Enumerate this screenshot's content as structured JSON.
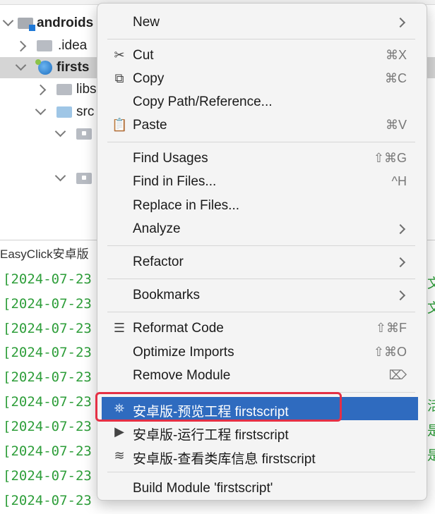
{
  "tree": {
    "items": [
      {
        "label": "androids",
        "bold": true
      },
      {
        "label": ".idea"
      },
      {
        "label": "firsts",
        "bold": true
      },
      {
        "label": "libs"
      },
      {
        "label": "src"
      }
    ]
  },
  "console": {
    "tab_label": "EasyClick安卓版",
    "log_lines": [
      "[2024-07-23",
      "[2024-07-23",
      "[2024-07-23",
      "[2024-07-23",
      "[2024-07-23",
      "[2024-07-23",
      "[2024-07-23",
      "[2024-07-23",
      "[2024-07-23",
      "[2024-07-23"
    ],
    "right_fragments": [
      "板文",
      "板文",
      "激活",
      "码是",
      "口是"
    ]
  },
  "menu": {
    "new": {
      "label": "New"
    },
    "cut": {
      "label": "Cut",
      "shortcut": "⌘X"
    },
    "copy": {
      "label": "Copy",
      "shortcut": "⌘C"
    },
    "copy_path": {
      "label": "Copy Path/Reference..."
    },
    "paste": {
      "label": "Paste",
      "shortcut": "⌘V"
    },
    "find_usages": {
      "label": "Find Usages",
      "shortcut": "⇧⌘G"
    },
    "find_in_files": {
      "label": "Find in Files...",
      "shortcut": "^H"
    },
    "replace_in_files": {
      "label": "Replace in Files..."
    },
    "analyze": {
      "label": "Analyze"
    },
    "refactor": {
      "label": "Refactor"
    },
    "bookmarks": {
      "label": "Bookmarks"
    },
    "reformat": {
      "label": "Reformat Code",
      "shortcut": "⇧⌘F"
    },
    "optimize_imports": {
      "label": "Optimize Imports",
      "shortcut": "⇧⌘O"
    },
    "remove_module": {
      "label": "Remove Module",
      "shortcut": "⌦"
    },
    "preview_project": {
      "label": "安卓版-预览工程 firstscript"
    },
    "run_project": {
      "label": "安卓版-运行工程 firstscript"
    },
    "view_libs": {
      "label": "安卓版-查看类库信息 firstscript"
    },
    "build_module": {
      "label": "Build Module 'firstscript'"
    }
  },
  "colors": {
    "highlight": "#2f6bbf",
    "annotation_box": "#e53045",
    "log_text": "#2e9e3a"
  },
  "icons": [
    "folder-icon",
    "module-icon",
    "android-globe-icon",
    "cut-icon",
    "copy-icon",
    "paste-icon",
    "reformat-icon",
    "run-icon",
    "libs-icon",
    "chevron-right-icon",
    "chevron-down-icon",
    "delete-key-icon"
  ]
}
